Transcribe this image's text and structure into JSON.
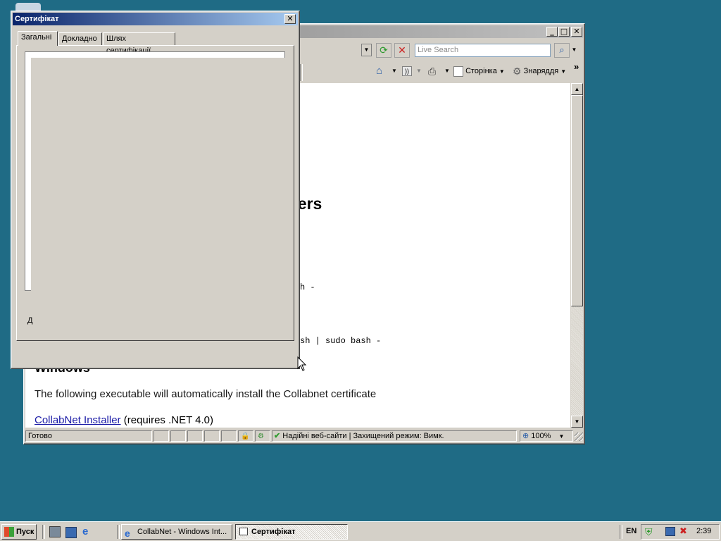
{
  "colors": {
    "desktop": "#1f6b85",
    "title_active": "#0a246a",
    "link": "#1a1aa6"
  },
  "ie": {
    "search_placeholder": "Live Search",
    "toolbar": {
      "page_label": "Сторінка",
      "tools_label": "Знаряддя",
      "more": "»"
    },
    "content": {
      "heading_fragment": "llers",
      "code_line_1": "h -",
      "code_line_2": "sh | sudo bash -",
      "windows_heading": "Windows",
      "description": "The following executable will automatically install the Collabnet certificate",
      "link_text": "CollabNet Installer",
      "link_suffix": " (requires .NET 4.0)"
    },
    "status": {
      "ready": "Готово",
      "zone": "Надійні веб-сайти | Захищений режим: Вимк.",
      "zoom": "100%"
    }
  },
  "cert": {
    "title": "Сертифікат",
    "tabs": [
      "Загальні",
      "Докладно",
      "Шлях сертифікації"
    ],
    "fragment_text": "Д"
  },
  "taskbar": {
    "start_label": "Пуск",
    "tasks": [
      "CollabNet - Windows Int...",
      "Сертифікат"
    ],
    "lang": "EN",
    "clock": "2:39"
  }
}
